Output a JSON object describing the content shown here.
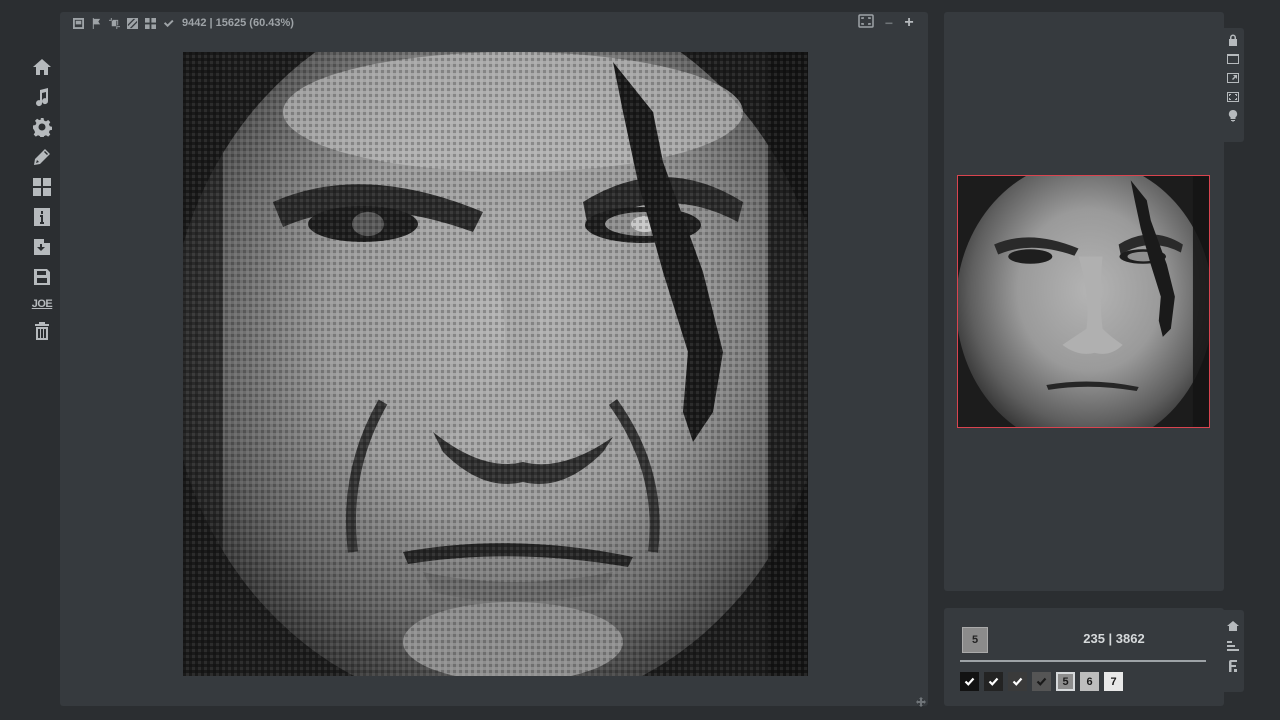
{
  "toolbar": {
    "progress_text": "9442 | 15625 (60.43%)"
  },
  "sidebar": {
    "items": [
      {
        "name": "home-icon"
      },
      {
        "name": "music-icon"
      },
      {
        "name": "gear-icon"
      },
      {
        "name": "pencil-icon"
      },
      {
        "name": "dashboard-icon"
      },
      {
        "name": "info-icon"
      },
      {
        "name": "import-icon"
      },
      {
        "name": "save-icon"
      },
      {
        "name": "joe-icon",
        "label": "JOE"
      },
      {
        "name": "trash-icon"
      }
    ]
  },
  "palette_panel": {
    "selected_label": "5",
    "counts": "235  |  3862",
    "swatches": [
      {
        "label": "",
        "bg": "#121212",
        "done": true
      },
      {
        "label": "",
        "bg": "#232323",
        "done": true
      },
      {
        "label": "",
        "bg": "#3a3a3a",
        "done": true
      },
      {
        "label": "",
        "bg": "#555555",
        "done": true
      },
      {
        "label": "5",
        "bg": "#8d8d8d",
        "done": false
      },
      {
        "label": "6",
        "bg": "#bdbdbd",
        "done": false
      },
      {
        "label": "7",
        "bg": "#e8e8e8",
        "done": false
      }
    ]
  },
  "colors": {
    "background": "#2b2e31",
    "panel": "#363a3e",
    "accent_border": "#d9444f",
    "icon": "#b6babd"
  }
}
